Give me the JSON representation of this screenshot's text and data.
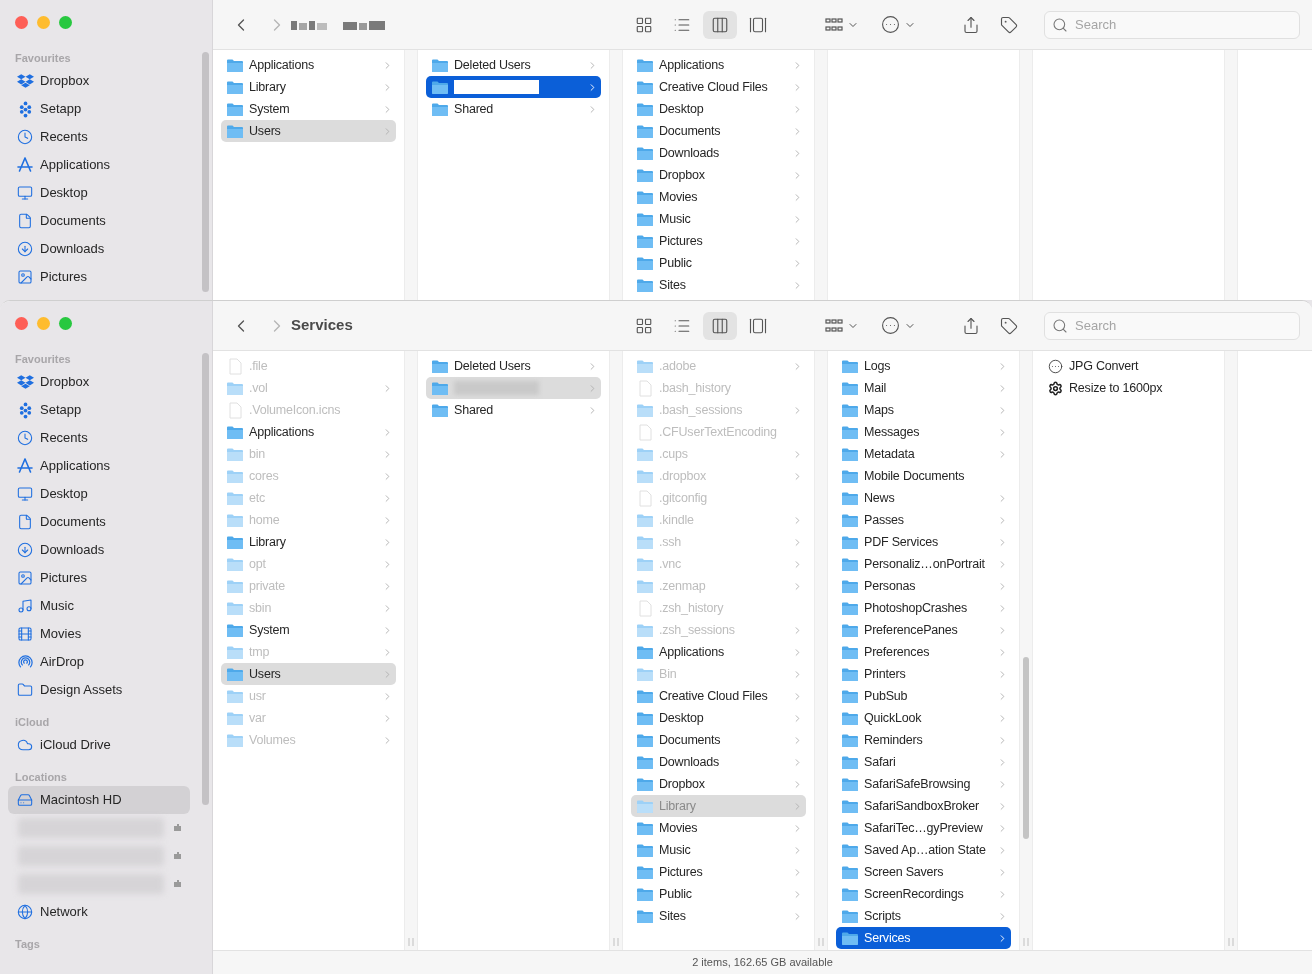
{
  "windows": [
    {
      "toolbar": {
        "views": [
          {
            "kind": "icons",
            "selected": false
          },
          {
            "kind": "list",
            "selected": false
          },
          {
            "kind": "columns",
            "selected": true
          },
          {
            "kind": "gallery",
            "selected": false
          }
        ],
        "search": {
          "placeholder": "Search"
        }
      },
      "sidebar": {
        "sections": [
          {
            "heading": "Favourites",
            "items": [
              {
                "label": "Dropbox",
                "kind": "dropbox",
                "selected": false
              },
              {
                "label": "Setapp",
                "kind": "setapp",
                "selected": false
              },
              {
                "label": "Recents",
                "kind": "clock",
                "selected": false
              },
              {
                "label": "Applications",
                "kind": "apps",
                "selected": false
              },
              {
                "label": "Desktop",
                "kind": "desktop",
                "selected": false
              },
              {
                "label": "Documents",
                "kind": "document",
                "selected": false
              },
              {
                "label": "Downloads",
                "kind": "download",
                "selected": false
              },
              {
                "label": "Pictures",
                "kind": "pictures",
                "selected": false
              }
            ]
          }
        ]
      },
      "columns": [
        {
          "active": false,
          "items": [
            {
              "label": "Applications",
              "kind": "folder",
              "hidden": false,
              "expandable": true,
              "selected": false
            },
            {
              "label": "Library",
              "kind": "folder",
              "hidden": false,
              "expandable": true,
              "selected": false
            },
            {
              "label": "System",
              "kind": "folder",
              "hidden": false,
              "expandable": true,
              "selected": false
            },
            {
              "label": "Users",
              "kind": "folder",
              "hidden": false,
              "expandable": true,
              "selected": true
            }
          ]
        },
        {
          "active": true,
          "items": [
            {
              "label": "Deleted Users",
              "kind": "folder",
              "hidden": false,
              "expandable": true,
              "selected": false
            },
            {
              "kind": "redacted",
              "hidden": false,
              "expandable": true,
              "selected": true
            },
            {
              "label": "Shared",
              "kind": "folder",
              "hidden": false,
              "expandable": true,
              "selected": false
            }
          ]
        },
        {
          "items": [
            {
              "label": "Applications",
              "kind": "folder",
              "hidden": false,
              "expandable": true,
              "selected": false
            },
            {
              "label": "Creative Cloud Files",
              "kind": "folder",
              "hidden": false,
              "expandable": true,
              "selected": false
            },
            {
              "label": "Desktop",
              "kind": "folder",
              "hidden": false,
              "expandable": true,
              "selected": false
            },
            {
              "label": "Documents",
              "kind": "folder",
              "hidden": false,
              "expandable": true,
              "selected": false
            },
            {
              "label": "Downloads",
              "kind": "folder",
              "hidden": false,
              "expandable": true,
              "selected": false
            },
            {
              "label": "Dropbox",
              "kind": "folder",
              "hidden": false,
              "expandable": true,
              "selected": false
            },
            {
              "label": "Movies",
              "kind": "folder",
              "hidden": false,
              "expandable": true,
              "selected": false
            },
            {
              "label": "Music",
              "kind": "folder",
              "hidden": false,
              "expandable": true,
              "selected": false
            },
            {
              "label": "Pictures",
              "kind": "folder",
              "hidden": false,
              "expandable": true,
              "selected": false
            },
            {
              "label": "Public",
              "kind": "folder",
              "hidden": false,
              "expandable": true,
              "selected": false
            },
            {
              "label": "Sites",
              "kind": "folder",
              "hidden": false,
              "expandable": true,
              "selected": false
            }
          ]
        }
      ]
    },
    {
      "toolbar": {
        "title": "Services",
        "views": [
          {
            "kind": "icons",
            "selected": false
          },
          {
            "kind": "list",
            "selected": false
          },
          {
            "kind": "columns",
            "selected": true
          },
          {
            "kind": "gallery",
            "selected": false
          }
        ],
        "search": {
          "placeholder": "Search"
        }
      },
      "sidebar": {
        "sections": [
          {
            "heading": "Favourites",
            "items": [
              {
                "label": "Dropbox",
                "kind": "dropbox",
                "selected": false
              },
              {
                "label": "Setapp",
                "kind": "setapp",
                "selected": false
              },
              {
                "label": "Recents",
                "kind": "clock",
                "selected": false
              },
              {
                "label": "Applications",
                "kind": "apps",
                "selected": false
              },
              {
                "label": "Desktop",
                "kind": "desktop",
                "selected": false
              },
              {
                "label": "Documents",
                "kind": "document",
                "selected": false
              },
              {
                "label": "Downloads",
                "kind": "download",
                "selected": false
              },
              {
                "label": "Pictures",
                "kind": "pictures",
                "selected": false
              },
              {
                "label": "Music",
                "kind": "music",
                "selected": false
              },
              {
                "label": "Movies",
                "kind": "movies",
                "selected": false
              },
              {
                "label": "AirDrop",
                "kind": "airdrop",
                "selected": false
              },
              {
                "label": "Design Assets",
                "kind": "folder",
                "selected": false
              }
            ]
          },
          {
            "heading": "iCloud",
            "items": [
              {
                "label": "iCloud Drive",
                "kind": "cloud",
                "selected": false
              }
            ]
          },
          {
            "heading": "Locations",
            "items": [
              {
                "label": "Macintosh HD",
                "kind": "disk",
                "selected": true
              },
              {
                "kind": "blurred",
                "selected": false
              },
              {
                "kind": "blurred",
                "selected": false
              },
              {
                "kind": "blurred",
                "selected": false
              },
              {
                "label": "Network",
                "kind": "globe",
                "selected": false
              }
            ]
          },
          {
            "heading": "Tags"
          }
        ]
      },
      "columns": [
        {
          "active": false,
          "items": [
            {
              "label": ".file",
              "kind": "file",
              "hidden": true,
              "expandable": false,
              "selected": false
            },
            {
              "label": ".vol",
              "kind": "folder",
              "hidden": true,
              "expandable": true,
              "selected": false
            },
            {
              "label": ".VolumeIcon.icns",
              "kind": "file",
              "hidden": true,
              "expandable": false,
              "selected": false
            },
            {
              "label": "Applications",
              "kind": "folder",
              "hidden": false,
              "expandable": true,
              "selected": false
            },
            {
              "label": "bin",
              "kind": "folder",
              "hidden": true,
              "expandable": true,
              "selected": false
            },
            {
              "label": "cores",
              "kind": "folder",
              "hidden": true,
              "expandable": true,
              "selected": false
            },
            {
              "label": "etc",
              "kind": "folder",
              "hidden": true,
              "expandable": true,
              "selected": false
            },
            {
              "label": "home",
              "kind": "folder",
              "hidden": true,
              "expandable": true,
              "selected": false
            },
            {
              "label": "Library",
              "kind": "folder",
              "hidden": false,
              "expandable": true,
              "selected": false
            },
            {
              "label": "opt",
              "kind": "folder",
              "hidden": true,
              "expandable": true,
              "selected": false
            },
            {
              "label": "private",
              "kind": "folder",
              "hidden": true,
              "expandable": true,
              "selected": false
            },
            {
              "label": "sbin",
              "kind": "folder",
              "hidden": true,
              "expandable": true,
              "selected": false
            },
            {
              "label": "System",
              "kind": "folder",
              "hidden": false,
              "expandable": true,
              "selected": false
            },
            {
              "label": "tmp",
              "kind": "folder",
              "hidden": true,
              "expandable": true,
              "selected": false
            },
            {
              "label": "Users",
              "kind": "folder",
              "hidden": false,
              "expandable": true,
              "selected": true
            },
            {
              "label": "usr",
              "kind": "folder",
              "hidden": true,
              "expandable": true,
              "selected": false
            },
            {
              "label": "var",
              "kind": "folder",
              "hidden": true,
              "expandable": true,
              "selected": false
            },
            {
              "label": "Volumes",
              "kind": "folder",
              "hidden": true,
              "expandable": true,
              "selected": false
            }
          ]
        },
        {
          "active": false,
          "items": [
            {
              "label": "Deleted Users",
              "kind": "folder",
              "hidden": false,
              "expandable": true,
              "selected": false
            },
            {
              "kind": "redacted",
              "hidden": false,
              "expandable": true,
              "selected": true
            },
            {
              "label": "Shared",
              "kind": "folder",
              "hidden": false,
              "expandable": true,
              "selected": false
            }
          ]
        },
        {
          "active": false,
          "items": [
            {
              "label": ".adobe",
              "kind": "folder",
              "hidden": true,
              "expandable": true,
              "selected": false
            },
            {
              "label": ".bash_history",
              "kind": "file",
              "hidden": true,
              "expandable": false,
              "selected": false
            },
            {
              "label": ".bash_sessions",
              "kind": "folder",
              "hidden": true,
              "expandable": true,
              "selected": false
            },
            {
              "label": ".CFUserTextEncoding",
              "kind": "file",
              "hidden": true,
              "expandable": false,
              "selected": false
            },
            {
              "label": ".cups",
              "kind": "folder",
              "hidden": true,
              "expandable": true,
              "selected": false
            },
            {
              "label": ".dropbox",
              "kind": "folder",
              "hidden": true,
              "expandable": true,
              "selected": false
            },
            {
              "label": ".gitconfig",
              "kind": "file",
              "hidden": true,
              "expandable": false,
              "selected": false
            },
            {
              "label": ".kindle",
              "kind": "folder",
              "hidden": true,
              "expandable": true,
              "selected": false
            },
            {
              "label": ".ssh",
              "kind": "folder",
              "hidden": true,
              "expandable": true,
              "selected": false
            },
            {
              "label": ".vnc",
              "kind": "folder",
              "hidden": true,
              "expandable": true,
              "selected": false
            },
            {
              "label": ".zenmap",
              "kind": "folder",
              "hidden": true,
              "expandable": true,
              "selected": false
            },
            {
              "label": ".zsh_history",
              "kind": "file",
              "hidden": true,
              "expandable": false,
              "selected": false
            },
            {
              "label": ".zsh_sessions",
              "kind": "folder",
              "hidden": true,
              "expandable": true,
              "selected": false
            },
            {
              "label": "Applications",
              "kind": "folder",
              "hidden": false,
              "expandable": true,
              "selected": false
            },
            {
              "label": "Bin",
              "kind": "folder",
              "hidden": true,
              "expandable": true,
              "selected": false
            },
            {
              "label": "Creative Cloud Files",
              "kind": "folder",
              "hidden": false,
              "expandable": true,
              "selected": false
            },
            {
              "label": "Desktop",
              "kind": "folder",
              "hidden": false,
              "expandable": true,
              "selected": false
            },
            {
              "label": "Documents",
              "kind": "folder",
              "hidden": false,
              "expandable": true,
              "selected": false
            },
            {
              "label": "Downloads",
              "kind": "folder",
              "hidden": false,
              "expandable": true,
              "selected": false
            },
            {
              "label": "Dropbox",
              "kind": "folder",
              "hidden": false,
              "expandable": true,
              "selected": false
            },
            {
              "label": "Library",
              "kind": "folder",
              "hidden": true,
              "expandable": true,
              "selected": true
            },
            {
              "label": "Movies",
              "kind": "folder",
              "hidden": false,
              "expandable": true,
              "selected": false
            },
            {
              "label": "Music",
              "kind": "folder",
              "hidden": false,
              "expandable": true,
              "selected": false
            },
            {
              "label": "Pictures",
              "kind": "folder",
              "hidden": false,
              "expandable": true,
              "selected": false
            },
            {
              "label": "Public",
              "kind": "folder",
              "hidden": false,
              "expandable": true,
              "selected": false
            },
            {
              "label": "Sites",
              "kind": "folder",
              "hidden": false,
              "expandable": true,
              "selected": false
            }
          ]
        },
        {
          "active": true,
          "items": [
            {
              "label": "Logs",
              "kind": "folder",
              "hidden": false,
              "expandable": true,
              "selected": false
            },
            {
              "label": "Mail",
              "kind": "folder",
              "hidden": false,
              "expandable": true,
              "selected": false
            },
            {
              "label": "Maps",
              "kind": "folder",
              "hidden": false,
              "expandable": true,
              "selected": false
            },
            {
              "label": "Messages",
              "kind": "folder",
              "hidden": false,
              "expandable": true,
              "selected": false
            },
            {
              "label": "Metadata",
              "kind": "folder",
              "hidden": false,
              "expandable": true,
              "selected": false
            },
            {
              "label": "Mobile Documents",
              "kind": "folder",
              "hidden": false,
              "expandable": false,
              "selected": false
            },
            {
              "label": "News",
              "kind": "folder",
              "hidden": false,
              "expandable": true,
              "selected": false
            },
            {
              "label": "Passes",
              "kind": "folder",
              "hidden": false,
              "expandable": true,
              "selected": false
            },
            {
              "label": "PDF Services",
              "kind": "folder",
              "hidden": false,
              "expandable": true,
              "selected": false
            },
            {
              "label": "Personaliz…onPortrait",
              "kind": "folder",
              "hidden": false,
              "expandable": true,
              "selected": false
            },
            {
              "label": "Personas",
              "kind": "folder",
              "hidden": false,
              "expandable": true,
              "selected": false
            },
            {
              "label": "PhotoshopCrashes",
              "kind": "folder",
              "hidden": false,
              "expandable": true,
              "selected": false
            },
            {
              "label": "PreferencePanes",
              "kind": "folder",
              "hidden": false,
              "expandable": true,
              "selected": false
            },
            {
              "label": "Preferences",
              "kind": "folder",
              "hidden": false,
              "expandable": true,
              "selected": false
            },
            {
              "label": "Printers",
              "kind": "folder",
              "hidden": false,
              "expandable": true,
              "selected": false
            },
            {
              "label": "PubSub",
              "kind": "folder",
              "hidden": false,
              "expandable": true,
              "selected": false
            },
            {
              "label": "QuickLook",
              "kind": "folder",
              "hidden": false,
              "expandable": true,
              "selected": false
            },
            {
              "label": "Reminders",
              "kind": "folder",
              "hidden": false,
              "expandable": true,
              "selected": false
            },
            {
              "label": "Safari",
              "kind": "folder",
              "hidden": false,
              "expandable": true,
              "selected": false
            },
            {
              "label": "SafariSafeBrowsing",
              "kind": "folder",
              "hidden": false,
              "expandable": true,
              "selected": false
            },
            {
              "label": "SafariSandboxBroker",
              "kind": "folder",
              "hidden": false,
              "expandable": true,
              "selected": false
            },
            {
              "label": "SafariTec…gyPreview",
              "kind": "folder",
              "hidden": false,
              "expandable": true,
              "selected": false
            },
            {
              "label": "Saved Ap…ation State",
              "kind": "folder",
              "hidden": false,
              "expandable": true,
              "selected": false
            },
            {
              "label": "Screen Savers",
              "kind": "folder",
              "hidden": false,
              "expandable": true,
              "selected": false
            },
            {
              "label": "ScreenRecordings",
              "kind": "folder",
              "hidden": false,
              "expandable": true,
              "selected": false
            },
            {
              "label": "Scripts",
              "kind": "folder",
              "hidden": false,
              "expandable": true,
              "selected": false
            },
            {
              "label": "Services",
              "kind": "folder",
              "hidden": false,
              "expandable": true,
              "selected": true
            }
          ]
        },
        {
          "items": [
            {
              "label": "JPG Convert",
              "kind": "workflow",
              "hidden": false,
              "expandable": false,
              "selected": false
            },
            {
              "label": "Resize to 1600px",
              "kind": "gear",
              "hidden": false,
              "expandable": false,
              "selected": false
            }
          ]
        }
      ],
      "status_bar": "2 items, 162.65 GB available"
    }
  ]
}
